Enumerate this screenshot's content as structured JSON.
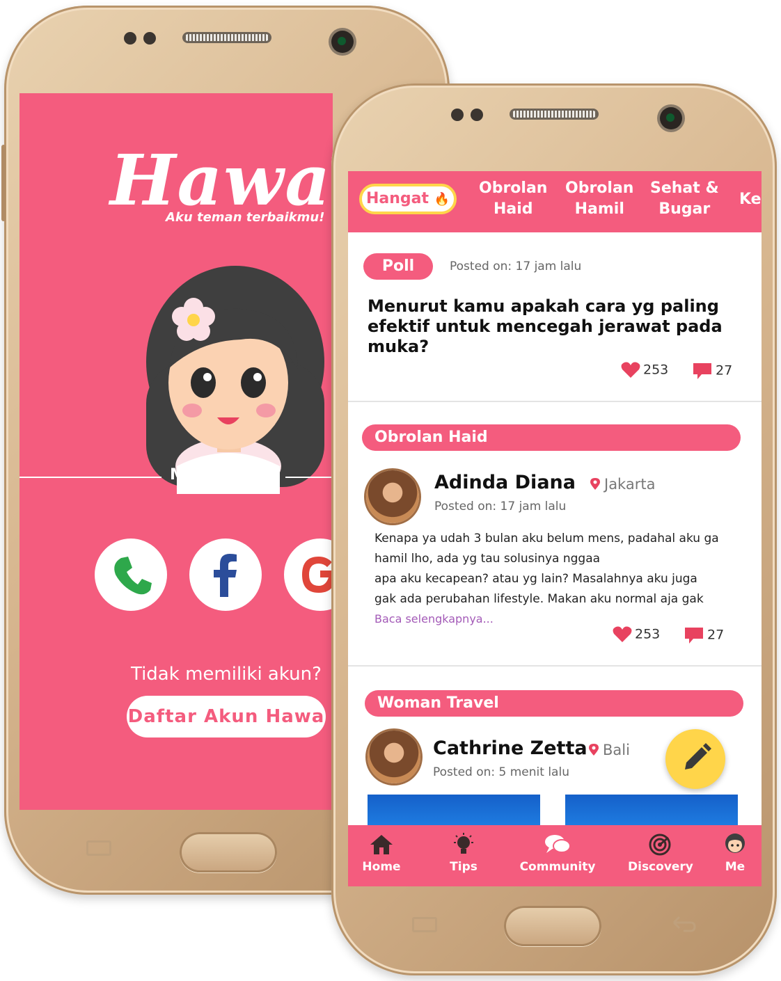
{
  "login_screen": {
    "logo": "Hawa",
    "tagline": "Aku teman terbaikmu!",
    "login_label": "Masuk Yuk!",
    "no_account_text": "Tidak memiliki akun?",
    "register_button": "Daftar Akun Hawa",
    "social_icons": [
      "phone-icon",
      "facebook-icon",
      "google-icon"
    ],
    "brand_color": "#f45c7e"
  },
  "community_screen": {
    "tabs": [
      {
        "label": "Hangat",
        "active": true
      },
      {
        "label": "Obrolan\nHaid"
      },
      {
        "label": "Obrolan\nHamil"
      },
      {
        "label": "Sehat &\nBugar"
      },
      {
        "label": "Ke"
      }
    ],
    "poll_post": {
      "badge": "Poll",
      "posted": "Posted on: 17 jam lalu",
      "question": "Menurut kamu apakah cara yg paling efektif untuk mencegah jerawat pada muka?",
      "likes": "253",
      "comments": "27"
    },
    "haid_post": {
      "category": "Obrolan Haid",
      "author": "Adinda Diana",
      "location": "Jakarta",
      "posted": "Posted on: 17 jam lalu",
      "body_lines": [
        "Kenapa ya udah 3 bulan aku belum mens, padahal aku ga",
        "hamil lho, ada yg tau solusinya nggaa",
        "apa aku kecapean? atau yg lain? Masalahnya aku juga",
        "gak ada perubahan lifestyle. Makan aku normal aja gak"
      ],
      "read_more": "Baca selengkapnya...",
      "likes": "253",
      "comments": "27"
    },
    "travel_post": {
      "category": "Woman Travel",
      "author": "Cathrine Zetta",
      "location": "Bali",
      "posted": "Posted on: 5 menit lalu"
    },
    "bottom_nav": [
      {
        "label": "Home",
        "icon": "home-icon"
      },
      {
        "label": "Tips",
        "icon": "lightbulb-icon"
      },
      {
        "label": "Community",
        "icon": "chat-icon"
      },
      {
        "label": "Discovery",
        "icon": "radar-icon"
      },
      {
        "label": "Me",
        "icon": "avatar-icon"
      }
    ],
    "accent_color": "#ffd54a"
  }
}
